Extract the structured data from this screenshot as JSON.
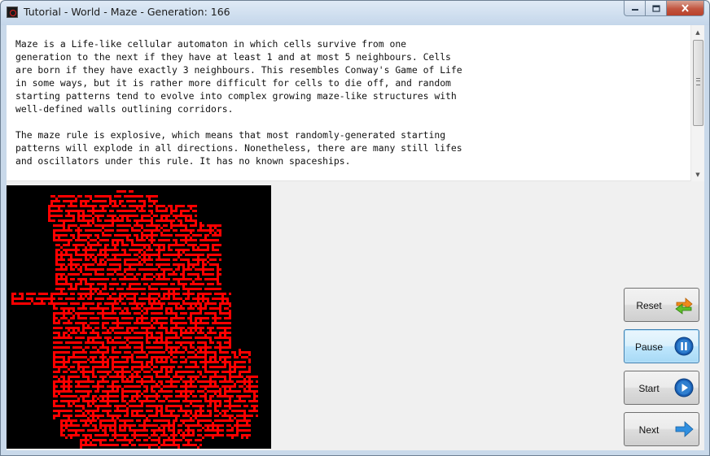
{
  "window": {
    "title": "Tutorial - World - Maze - Generation: 166"
  },
  "tutorial": {
    "text": "Maze is a Life-like cellular automaton in which cells survive from one\ngeneration to the next if they have at least 1 and at most 5 neighbours. Cells\nare born if they have exactly 3 neighbours. This resembles Conway's Game of Life\nin some ways, but it is rather more difficult for cells to die off, and random\nstarting patterns tend to evolve into complex growing maze-like structures with\nwell-defined walls outlining corridors.\n\nThe maze rule is explosive, which means that most randomly-generated starting\npatterns will explode in all directions. Nonetheless, there are many still lifes\nand oscillators under this rule. It has no known spaceships."
  },
  "world": {
    "generation": 166,
    "background_color": "#000000",
    "cell_color": "#ff0000"
  },
  "buttons": {
    "reset": "Reset",
    "pause": "Pause",
    "start": "Start",
    "next": "Next"
  },
  "colors": {
    "accent": "#2f7fcf",
    "reset_icon_orange": "#f08a1c",
    "reset_icon_green": "#5fbf2a"
  }
}
